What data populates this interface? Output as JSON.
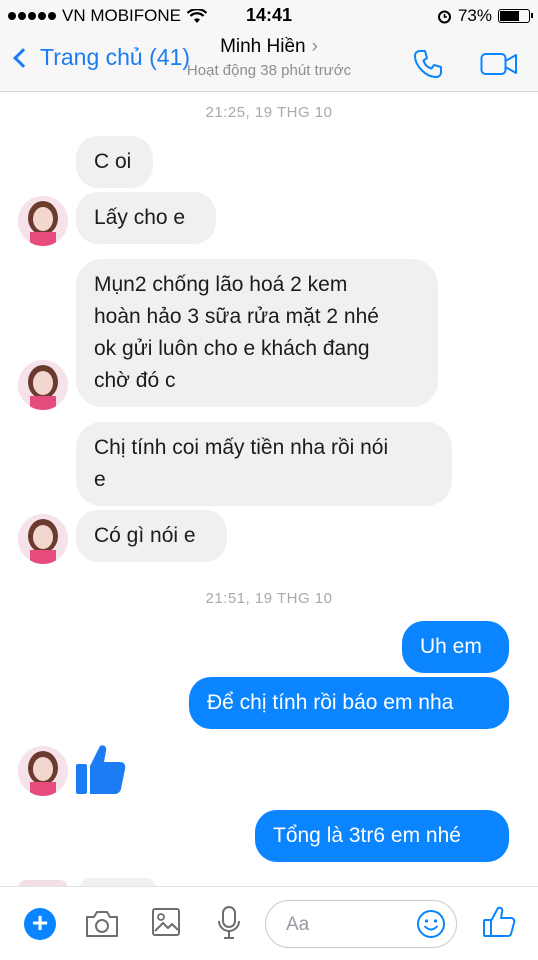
{
  "status": {
    "carrier": "VN MOBIFONE",
    "time": "14:41",
    "battery_percent_label": "73%",
    "battery_level": 0.73
  },
  "header": {
    "back_label": "Trang chủ (41)",
    "contact_name": "Minh Hiền",
    "activity": "Hoạt động 38 phút trước",
    "icons": [
      "phone-icon",
      "video-camera-icon"
    ]
  },
  "timestamps": [
    "21:25, 19 THG 10",
    "21:51, 19 THG 10"
  ],
  "messages": {
    "m1": "C oi",
    "m2": "Lấy cho e",
    "m3_l1": "Mụn2 chống lão hoá 2 kem",
    "m3_l2": "hoàn hảo 3 sữa rửa mặt 2 nhé",
    "m3_l3": "ok gửi luôn cho e khách đang",
    "m3_l4": "chờ đó c",
    "m4_l1": "Chị tính coi mấy tiền nha rồi nói",
    "m4_l2": "e",
    "m5": "Có gì nói e",
    "m6": "Uh em",
    "m7": "Để chị tính rồi báo em nha",
    "m8": "Tổng là 3tr6 em nhé"
  },
  "composer": {
    "placeholder": "Aa",
    "icons": [
      "plus-icon",
      "camera-icon",
      "image-icon",
      "microphone-icon",
      "emoji-icon",
      "like-icon"
    ]
  },
  "colors": {
    "accent": "#0a84ff",
    "incoming_bubble": "#f1f0f0",
    "timestamp": "#a8a8ad"
  }
}
